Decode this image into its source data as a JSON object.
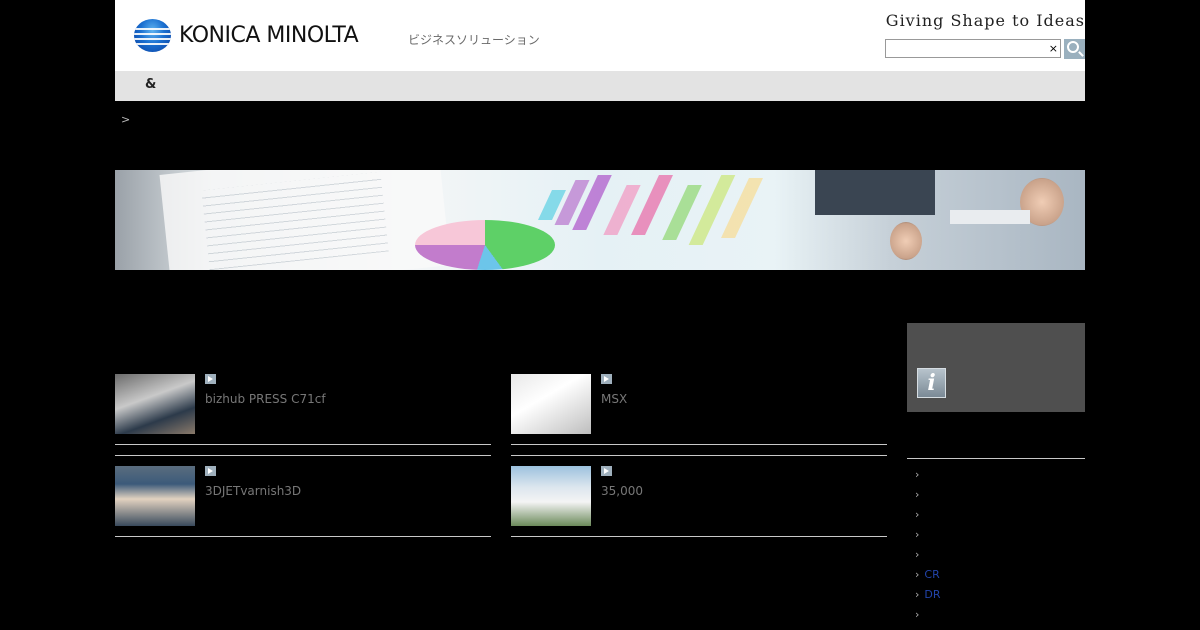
{
  "header": {
    "brand_name": "KONICA MINOLTA",
    "subtitle": "ビジネスソリューション",
    "tagline": "Giving Shape to Ideas",
    "search": {
      "value": "",
      "clear_label": "×"
    }
  },
  "nav": {
    "label": "&"
  },
  "breadcrumb": {
    "separator": ">"
  },
  "articles": [
    {
      "title": "bizhub PRESS C71cf"
    },
    {
      "title": "MSX"
    },
    {
      "title": "3DJETvarnish3D"
    },
    {
      "title": "35,000"
    }
  ],
  "sidebar": {
    "info_icon_label": "i",
    "links": [
      {
        "label": ""
      },
      {
        "label": ""
      },
      {
        "label": ""
      },
      {
        "label": ""
      },
      {
        "label": ""
      },
      {
        "label": "CR"
      },
      {
        "label": "DR"
      },
      {
        "label": ""
      }
    ],
    "chevron": "›"
  },
  "colors": {
    "page_background": "#000000",
    "header_background": "#ffffff",
    "nav_background": "#e3e3e3",
    "side_box": "#4f4f4f",
    "link": "#2244aa"
  }
}
